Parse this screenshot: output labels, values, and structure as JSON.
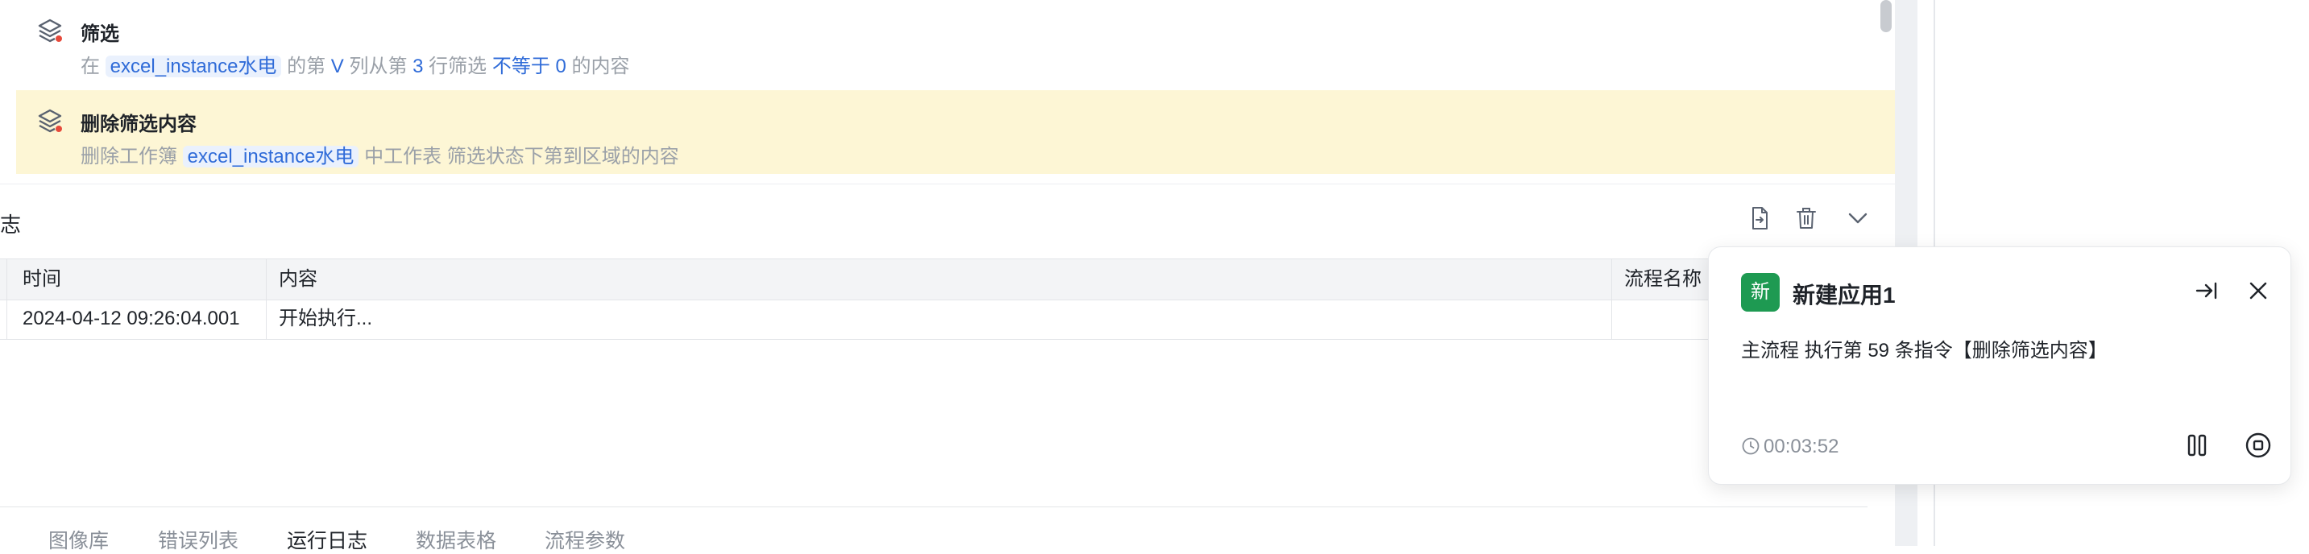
{
  "instructions": [
    {
      "title": "筛选",
      "desc": {
        "p1": "在",
        "workbook": "excel_instance水电",
        "p2": "的第",
        "col": "V",
        "p3": "列从第",
        "row": "3",
        "p4": "行筛选",
        "op": "不等于",
        "val": "0",
        "p5": "的内容"
      }
    },
    {
      "title": "删除筛选内容",
      "desc": {
        "p1": "删除工作簿",
        "workbook": "excel_instance水电",
        "p2": "中工作表",
        "p3": "筛选状态下第到区域的内容"
      }
    }
  ],
  "log": {
    "title_fragment": "志",
    "columns": {
      "time": "时间",
      "content": "内容",
      "flow": "流程名称"
    },
    "rows": [
      {
        "time": "2024-04-12 09:26:04.001",
        "content": "开始执行...",
        "flow": ""
      }
    ]
  },
  "tabs": [
    {
      "label": "图像库",
      "active": false
    },
    {
      "label": "错误列表",
      "active": false
    },
    {
      "label": "运行日志",
      "active": true
    },
    {
      "label": "数据表格",
      "active": false
    },
    {
      "label": "流程参数",
      "active": false
    }
  ],
  "popup": {
    "badge": "新",
    "title": "新建应用1",
    "message": "主流程 执行第 59 条指令【删除筛选内容】",
    "timer": "00:03:52"
  },
  "colors": {
    "accent_blue": "#2f6bd8",
    "selected_row": "#fdf6d5",
    "badge_green": "#1e9a52"
  },
  "icons": {
    "instruction": "layers-icon",
    "export": "export-file-icon",
    "delete": "trash-icon",
    "collapse": "chevron-down-icon",
    "minimize": "collapse-to-right-icon",
    "close": "close-icon",
    "timer": "clock-icon",
    "pause": "pause-icon",
    "stop": "stop-icon"
  }
}
